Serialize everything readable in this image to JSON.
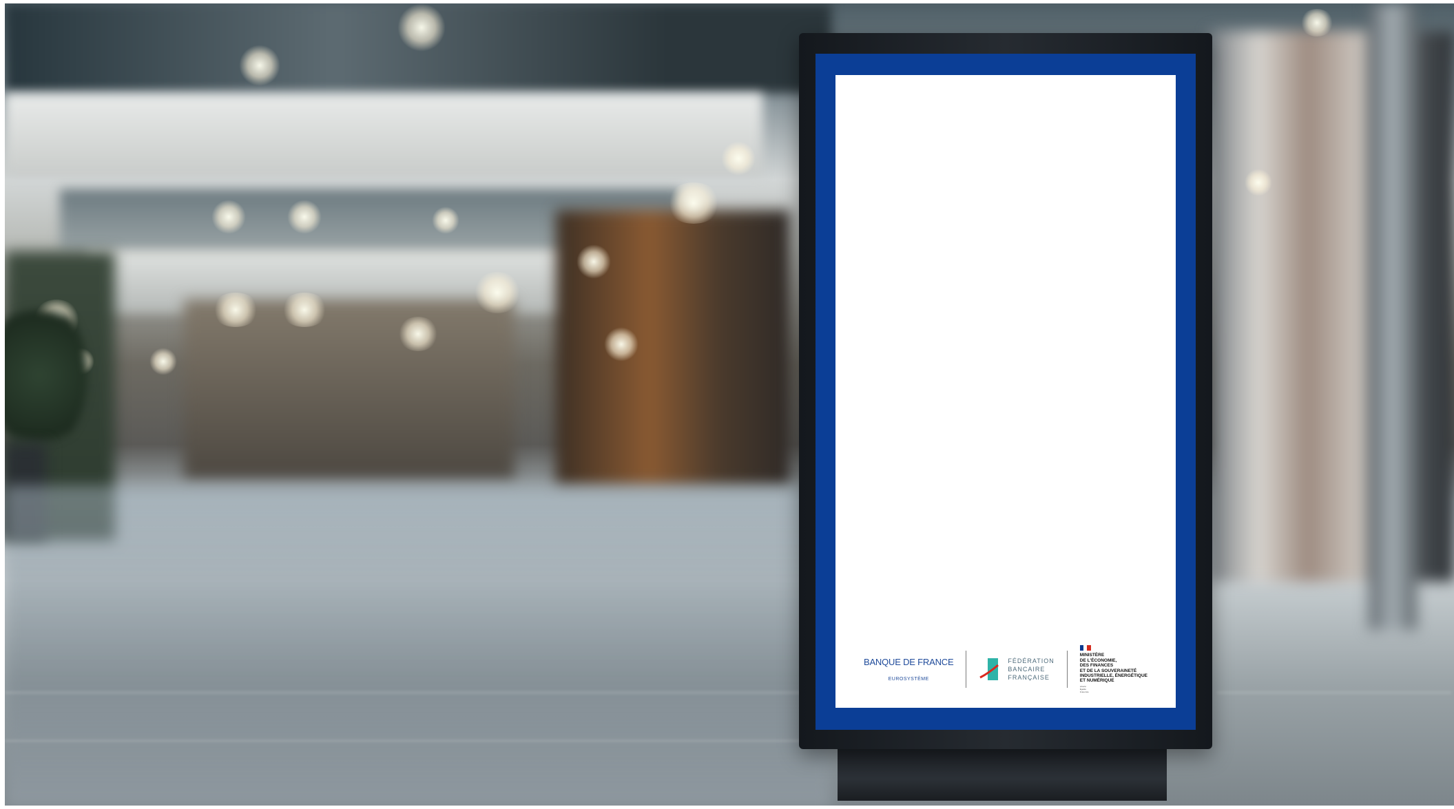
{
  "scene": {
    "colors": {
      "kiosk_border": "#0b3e96",
      "kiosk_frame": "#1b1f24",
      "screen": "#ffffff"
    }
  },
  "logos": {
    "banque_de_france": {
      "name": "BANQUE DE FRANCE",
      "subtitle": "EUROSYSTÈME"
    },
    "federation": {
      "line1": "FÉDÉRATION",
      "line2": "BANCAIRE",
      "line3": "FRANÇAISE"
    },
    "ministry": {
      "lines": [
        "MINISTÈRE",
        "DE L'ÉCONOMIE,",
        "DES FINANCES",
        "ET DE LA SOUVERAINETÉ",
        "INDUSTRIELLE, ÉNERGÉTIQUE",
        "ET NUMÉRIQUE"
      ],
      "motto": [
        "Liberté",
        "Égalité",
        "Fraternité"
      ]
    }
  }
}
